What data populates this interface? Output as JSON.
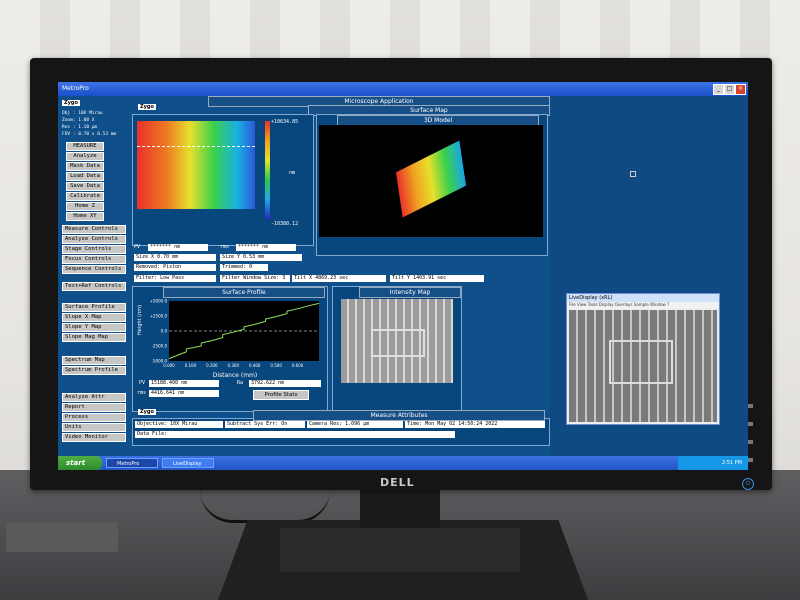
{
  "window": {
    "title": "MetroPro",
    "controls": [
      "_",
      "□",
      "×"
    ]
  },
  "main": {
    "panel_title": "Microscope Application",
    "info_lines": [
      "Obj : 10X Mirau",
      "Zoom: 1.00 X",
      "Res : 1.10 µm",
      "FOV : 0.70 x 0.53 mm"
    ],
    "side_buttons": [
      "MEASURE",
      "Analyze",
      "Mask Data",
      "Load Data",
      "Save Data",
      "Calibrate",
      "Home Z",
      "Home XY"
    ],
    "control_buttons": [
      "Measure Controls",
      "Analyze Controls",
      "Stage Controls",
      "Focus Controls",
      "Sequence Controls",
      "Test+Ref Controls",
      "Surface Profile",
      "Slope X Map",
      "Slope Y Map",
      "Slope Mag Map",
      "Spectrum Map",
      "Spectrum Profile",
      "Analyze Attr",
      "Report",
      "Process",
      "Units",
      "Video Monitor"
    ]
  },
  "surface_map": {
    "title": "Surface Map",
    "scale_max": "+10634.85",
    "scale_unit": "nm",
    "scale_min": "-10380.12",
    "model_title": "3D Model",
    "pv_label": "PV",
    "pv_value": "*******",
    "pv_unit": "nm",
    "rms_label": "rms",
    "rms_value": "*******",
    "rms_unit": "nm",
    "sizex_label": "Size X",
    "sizex_value": "0.70",
    "sizex_unit": "mm",
    "sizey_label": "Size Y",
    "sizey_value": "0.53",
    "sizey_unit": "mm",
    "removed_label": "Removed:",
    "removed_value": "Piston",
    "trimmed_label": "Trimmed:",
    "trimmed_value": "0",
    "filter_label": "Filter:",
    "filter_value": "Low Pass",
    "filter_window_label": "Filter Window Size:",
    "filter_window_value": "3",
    "tiltx_label": "Tilt X",
    "tiltx_value": "4869.23",
    "tiltx_unit": "sec",
    "tilty_label": "Tilt Y",
    "tilty_value": "1403.91",
    "tilty_unit": "sec"
  },
  "profile": {
    "title": "Surface Profile",
    "ylabel": "Height (nm)",
    "xlabel": "Distance (mm)",
    "y_ticks": [
      "+5000.0",
      "+2500.0",
      "0.0",
      "-2500.0",
      "-5000.0"
    ],
    "x_ticks": [
      "0.000",
      "0.100",
      "0.200",
      "0.300",
      "0.400",
      "0.500",
      "0.600"
    ],
    "pv_label": "PV",
    "pv_value": "15188.400",
    "pv_unit": "nm",
    "rms_label": "rms",
    "rms_value": "4416.641",
    "rms_unit": "nm",
    "ra_label": "Ra",
    "ra_value": "3792.622",
    "ra_unit": "nm",
    "stats_button": "Profile Stats"
  },
  "intensity": {
    "title": "Intensity Map"
  },
  "attributes": {
    "title": "Measure Attributes",
    "objective_label": "Objective:",
    "objective_value": "10X Mirau",
    "subtract_label": "Subtract Sys Err:",
    "subtract_value": "On",
    "camera_label": "Camera Res:",
    "camera_value": "1.096",
    "camera_unit": "µm",
    "time_label": "Time:",
    "time_value": "Mon May 02 14:50:24 2022",
    "datafile_label": "Data File:"
  },
  "live_display": {
    "title": "LiveDisplay (xRL)",
    "menu": "File  View  Tools  Display  Overlays  Sample  Window  ?"
  },
  "taskbar": {
    "start": "start",
    "tasks": [
      "MetroPro",
      "LiveDisplay (xRL)"
    ],
    "clock": "2:51 PM"
  },
  "monitor": {
    "brand": "DELL"
  },
  "chart_data": {
    "type": "line",
    "title": "Surface Profile",
    "xlabel": "Distance (mm)",
    "ylabel": "Height (nm)",
    "xlim": [
      0,
      0.7
    ],
    "ylim": [
      -5000,
      5000
    ],
    "x": [
      0.0,
      0.05,
      0.08,
      0.081,
      0.15,
      0.151,
      0.2,
      0.25,
      0.251,
      0.3,
      0.35,
      0.351,
      0.4,
      0.45,
      0.451,
      0.5,
      0.55,
      0.551,
      0.6,
      0.65,
      0.7
    ],
    "y": [
      -4600,
      -3900,
      -3500,
      -3000,
      -2500,
      -2000,
      -1600,
      -1100,
      -600,
      -200,
      300,
      700,
      1100,
      1600,
      2000,
      2400,
      2900,
      3300,
      3700,
      4200,
      4600
    ]
  }
}
